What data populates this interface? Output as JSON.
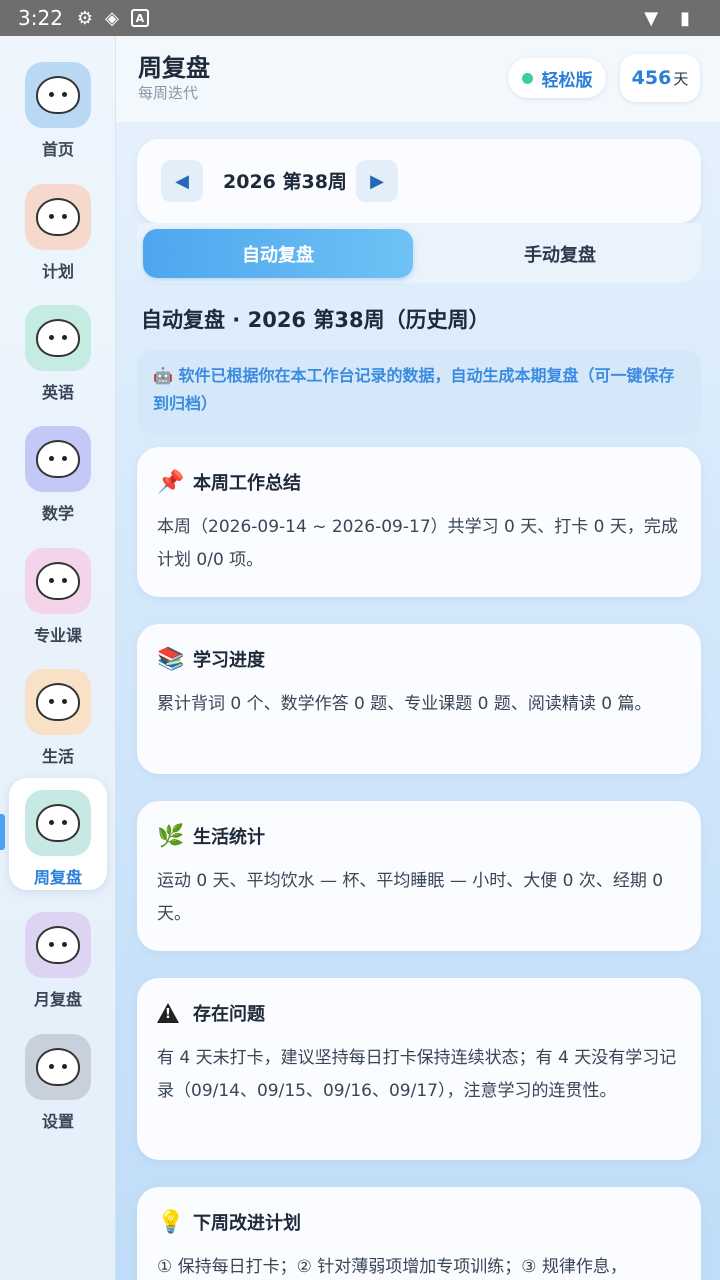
{
  "status_bar": {
    "time": "3:22"
  },
  "sidebar": {
    "items": [
      {
        "label": "首页"
      },
      {
        "label": "计划"
      },
      {
        "label": "英语"
      },
      {
        "label": "数学"
      },
      {
        "label": "专业课"
      },
      {
        "label": "生活"
      },
      {
        "label": "周复盘"
      },
      {
        "label": "月复盘"
      },
      {
        "label": "设置"
      }
    ],
    "active_index": 6
  },
  "header": {
    "title": "周复盘",
    "subtitle": "每周迭代",
    "mode": "轻松版",
    "days_count": "456",
    "days_unit": "天"
  },
  "week_selector": {
    "label": "2026 第38周"
  },
  "tabs": [
    {
      "label": "自动复盘"
    },
    {
      "label": "手动复盘"
    }
  ],
  "section_heading": "自动复盘 · 2026 第38周（历史周）",
  "notice": "🤖 软件已根据你在本工作台记录的数据，自动生成本期复盘（可一键保存到归档）",
  "cards": {
    "summary": {
      "icon": "📌",
      "title": "本周工作总结",
      "body": "本周（2026-09-14 ~ 2026-09-17）共学习 0 天、打卡 0 天，完成计划 0/0 项。"
    },
    "progress": {
      "icon": "📚",
      "title": "学习进度",
      "body": "累计背词 0 个、数学作答 0 题、专业课题 0 题、阅读精读 0 篇。"
    },
    "life": {
      "icon": "🌿",
      "title": "生活统计",
      "body": "运动 0 天、平均饮水 — 杯、平均睡眠 — 小时、大便 0 次、经期 0 天。"
    },
    "issues": {
      "title": "存在问题",
      "body": "有 4 天未打卡，建议坚持每日打卡保持连续状态；有 4 天没有学习记录（09/14、09/15、09/16、09/17），注意学习的连贯性。"
    },
    "plan": {
      "icon": "💡",
      "title": "下周改进计划",
      "body": "① 保持每日打卡；② 针对薄弱项增加专项训练；③ 规律作息，"
    }
  },
  "colors": {
    "accent": "#2a7fd9",
    "tab_active": "#4ea6ee",
    "notice_text": "#3b8be0",
    "status_dot": "#3ccf9a"
  }
}
